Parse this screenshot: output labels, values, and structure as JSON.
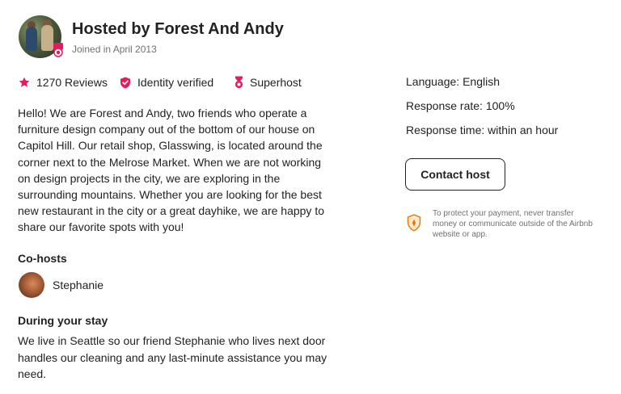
{
  "host": {
    "title": "Hosted by Forest And Andy",
    "joined": "Joined in April 2013"
  },
  "stats": {
    "reviews": "1270 Reviews",
    "identity": "Identity verified",
    "superhost": "Superhost"
  },
  "about": "Hello! We are Forest and Andy, two friends who operate a furniture design company out of the bottom of our house on Capitol Hill. Our retail shop, Glasswing, is located around the corner next to the Melrose Market. When we are not working on design projects in the city, we are exploring in the surrounding mountains. Whether you are looking for the best new restaurant in the city or a great dayhike, we are happy to share our favorite spots with you!",
  "cohosts": {
    "heading": "Co-hosts",
    "items": [
      {
        "name": "Stephanie"
      }
    ]
  },
  "stay": {
    "heading": "During your stay",
    "text": "We live in Seattle so our friend Stephanie who lives next door handles our cleaning and any last-minute assistance you may need."
  },
  "details": {
    "language": "Language: English",
    "response_rate": "Response rate: 100%",
    "response_time": "Response time: within an hour"
  },
  "contact_button": "Contact host",
  "protect_note": "To protect your payment, never transfer money or communicate outside of the Airbnb website or app.",
  "colors": {
    "accent": "#E31C5F",
    "text": "#222222",
    "muted": "#717171",
    "shield": "#E07912"
  },
  "icons": [
    "star-icon",
    "verified-shield-icon",
    "superhost-medal-icon",
    "payment-shield-icon"
  ]
}
